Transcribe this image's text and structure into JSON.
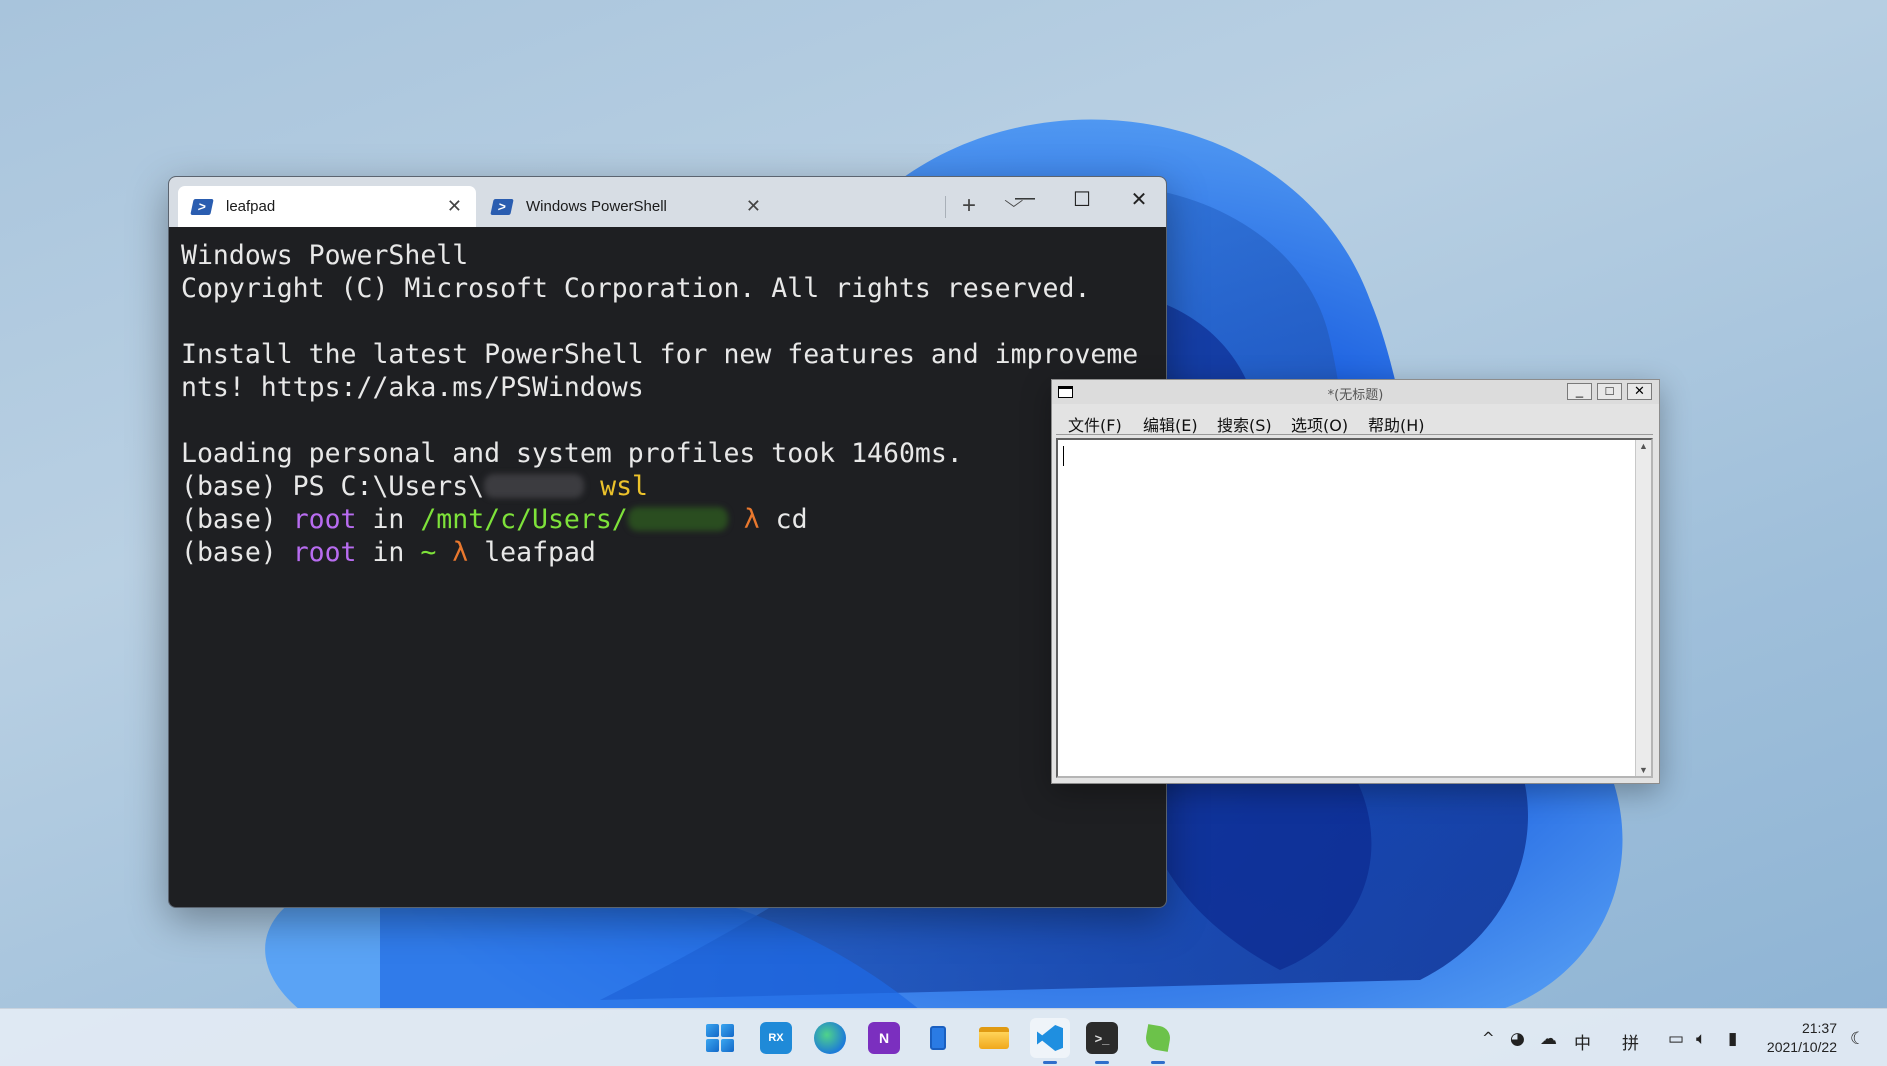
{
  "desktop": {
    "wallpaper": "windows-11-bloom"
  },
  "terminal": {
    "tabs": [
      {
        "title": "leafpad",
        "icon": "powershell-icon",
        "active": true
      },
      {
        "title": "Windows PowerShell",
        "icon": "powershell-icon",
        "active": false
      }
    ],
    "new_tab": "+",
    "dropdown": "⌵",
    "controls": {
      "minimize": "—",
      "maximize": "☐",
      "close": "✕"
    },
    "lines": {
      "l1": "Windows PowerShell",
      "l2": "Copyright (C) Microsoft Corporation. All rights reserved.",
      "l3": "Install the latest PowerShell for new features and improveme",
      "l4": "nts! https://aka.ms/PSWindows",
      "l5": "Loading personal and system profiles took 1460ms.",
      "l6_prefix": "(base) PS C:\\Users\\",
      "l6_cmd": "wsl",
      "l7_prefix": "(base) ",
      "l7_user": "root",
      "l7_in": " in ",
      "l7_path": "/mnt/c/Users/",
      "l7_lambda": "λ",
      "l7_cmd": " cd",
      "l8_prefix": "(base) ",
      "l8_user": "root",
      "l8_in": " in ",
      "l8_path": "~",
      "l8_lambda": "λ",
      "l8_cmd": " leafpad"
    },
    "colors": {
      "background": "#1e1f22",
      "user": "#b86cf0",
      "path": "#7ee23a",
      "lambda": "#e9782e",
      "command": "#ecc22b"
    }
  },
  "leafpad": {
    "title": "*(无标题)",
    "menus": [
      "文件(F)",
      "编辑(E)",
      "搜索(S)",
      "选项(O)",
      "帮助(H)"
    ],
    "controls": {
      "minimize": "_",
      "maximize": "□",
      "close": "✕"
    },
    "content": ""
  },
  "taskbar": {
    "apps": [
      {
        "name": "start-button",
        "icon": "windows-start-icon"
      },
      {
        "name": "taskbar-app-rx",
        "icon": "rx-app-icon",
        "label": "RX"
      },
      {
        "name": "taskbar-app-edge",
        "icon": "edge-icon"
      },
      {
        "name": "taskbar-app-onenote",
        "icon": "onenote-icon",
        "label": "N"
      },
      {
        "name": "taskbar-app-phone",
        "icon": "phone-link-icon"
      },
      {
        "name": "taskbar-app-explorer",
        "icon": "folder-icon"
      },
      {
        "name": "taskbar-app-vscode",
        "icon": "vscode-icon"
      },
      {
        "name": "taskbar-app-terminal",
        "icon": "terminal-icon"
      },
      {
        "name": "taskbar-app-leafpad",
        "icon": "leafpad-icon"
      }
    ],
    "tray": {
      "chevron": "^",
      "ime_mode": "中",
      "ime_layout": "拼"
    },
    "clock": {
      "time": "21:37",
      "date": "2021/10/22"
    }
  }
}
